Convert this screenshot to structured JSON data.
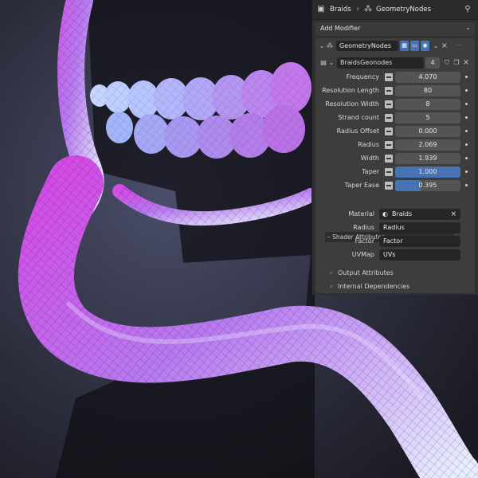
{
  "header": {
    "breadcrumb_object": "Braids",
    "breadcrumb_modifier": "GeometryNodes"
  },
  "add_modifier": {
    "label": "Add Modifier"
  },
  "modifier": {
    "name": "GeometryNodes",
    "node_group": "BraidsGeonodes",
    "user_count": "4"
  },
  "properties": [
    {
      "label": "Frequency",
      "value": "4.070"
    },
    {
      "label": "Resolution Length",
      "value": "80"
    },
    {
      "label": "Resolution Width",
      "value": "8"
    },
    {
      "label": "Strand count",
      "value": "5"
    },
    {
      "label": "Radius Offset",
      "value": "0.000"
    },
    {
      "label": "Radius",
      "value": "2.069"
    },
    {
      "label": "Width",
      "value": "1.939"
    },
    {
      "label": "Taper",
      "value": "1.000",
      "fill": 1.0
    },
    {
      "label": "Taper Ease",
      "value": "0.395",
      "fill": 0.395
    }
  ],
  "shader_section": {
    "label": "– Shader Attributes –"
  },
  "shader_attributes": [
    {
      "label": "Material",
      "value": "Braids"
    },
    {
      "label": "Radius",
      "value": "Radius"
    },
    {
      "label": "Factor",
      "value": "Factor"
    },
    {
      "label": "UVMap",
      "value": "UVs"
    }
  ],
  "subpanels": [
    {
      "label": "Output Attributes"
    },
    {
      "label": "Internal Dependencies"
    }
  ],
  "colors": {
    "accent": "#4772b3",
    "braid_pink": "#d44be6",
    "braid_blue": "#c8d6ff",
    "panel_bg": "#303030"
  }
}
